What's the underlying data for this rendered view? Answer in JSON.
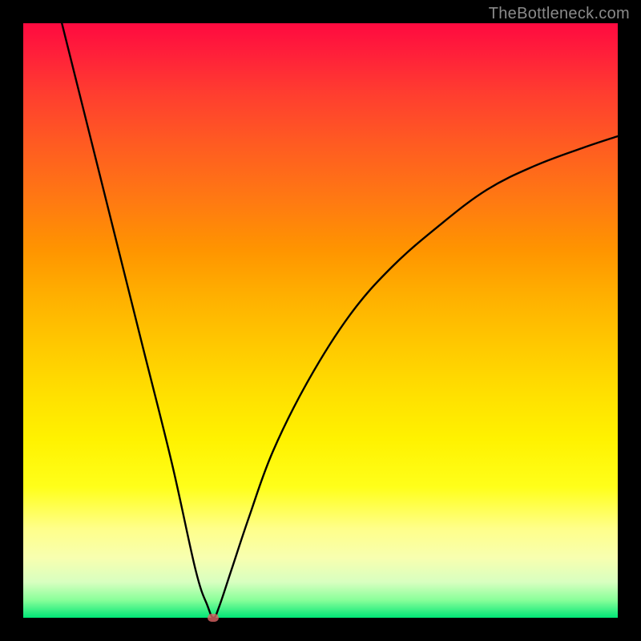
{
  "watermark": "TheBottleneck.com",
  "chart_data": {
    "type": "line",
    "title": "",
    "xlabel": "",
    "ylabel": "",
    "xlim": [
      0,
      100
    ],
    "ylim": [
      0,
      100
    ],
    "grid": false,
    "legend": false,
    "curve": {
      "points": [
        {
          "x": 5,
          "y": 106
        },
        {
          "x": 10,
          "y": 86
        },
        {
          "x": 15,
          "y": 66
        },
        {
          "x": 20,
          "y": 46
        },
        {
          "x": 25,
          "y": 26
        },
        {
          "x": 29,
          "y": 8
        },
        {
          "x": 31,
          "y": 2
        },
        {
          "x": 32,
          "y": 0
        },
        {
          "x": 33,
          "y": 2
        },
        {
          "x": 35,
          "y": 8
        },
        {
          "x": 38,
          "y": 17
        },
        {
          "x": 42,
          "y": 28
        },
        {
          "x": 48,
          "y": 40
        },
        {
          "x": 55,
          "y": 51
        },
        {
          "x": 62,
          "y": 59
        },
        {
          "x": 70,
          "y": 66
        },
        {
          "x": 78,
          "y": 72
        },
        {
          "x": 86,
          "y": 76
        },
        {
          "x": 94,
          "y": 79
        },
        {
          "x": 100,
          "y": 81
        }
      ]
    },
    "marker": {
      "x": 32,
      "y": 0
    },
    "background": "red-yellow-green vertical gradient (high=bad, low=good)"
  },
  "colors": {
    "frame": "#000000",
    "curve": "#000000",
    "marker": "#e06666"
  }
}
